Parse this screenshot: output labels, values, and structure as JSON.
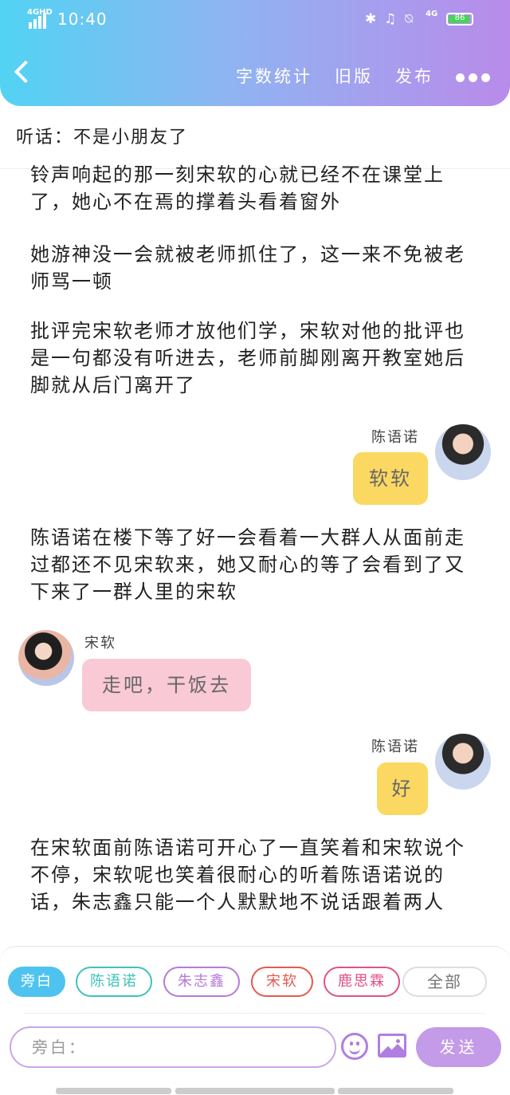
{
  "status_bar": {
    "network": "4GHD",
    "time": "10:40",
    "network2": "4G",
    "battery": "86"
  },
  "header": {
    "nav": [
      "字数统计",
      "旧版",
      "发布"
    ]
  },
  "subtitle": "听话：不是小朋友了",
  "paragraphs": [
    "铃声响起的那一刻宋软的心就已经不在课堂上了，她心不在焉的撑着头看着窗外",
    "她游神没一会就被老师抓住了，这一来不免被老师骂一顿",
    "批评完宋软老师才放他们学，宋软对他的批评也是一句都没有听进去，老师前脚刚离开教室她后脚就从后门离开了",
    "陈语诺在楼下等了好一会看着一大群人从面前走过都还不见宋软来，她又耐心的等了会看到了又下来了一群人里的宋软",
    "在宋软面前陈语诺可开心了一直笑着和宋软说个不停，宋软呢也笑着很耐心的听着陈语诺说的话，朱志鑫只能一个人默默地不说话跟着两人"
  ],
  "messages": [
    {
      "speaker": "陈语诺",
      "text": "软软"
    },
    {
      "speaker": "宋软",
      "text": "走吧，干饭去"
    },
    {
      "speaker": "陈语诺",
      "text": "好"
    }
  ],
  "role_chips": [
    {
      "label": "旁白",
      "color": "#4fc3f0"
    },
    {
      "label": "陈语诺",
      "color": "#3ec2b8"
    },
    {
      "label": "朱志鑫",
      "color": "#b67ad8"
    },
    {
      "label": "宋软",
      "color": "#e45a4e"
    },
    {
      "label": "鹿思霖",
      "color": "#e0508a"
    },
    {
      "label": "全部",
      "color": "#dddddd"
    }
  ],
  "input": {
    "placeholder": "旁白："
  },
  "send_label": "发送",
  "colors": {
    "header_start": "#52d3f3",
    "header_end": "#b98bea",
    "accent": "#c39be8"
  }
}
